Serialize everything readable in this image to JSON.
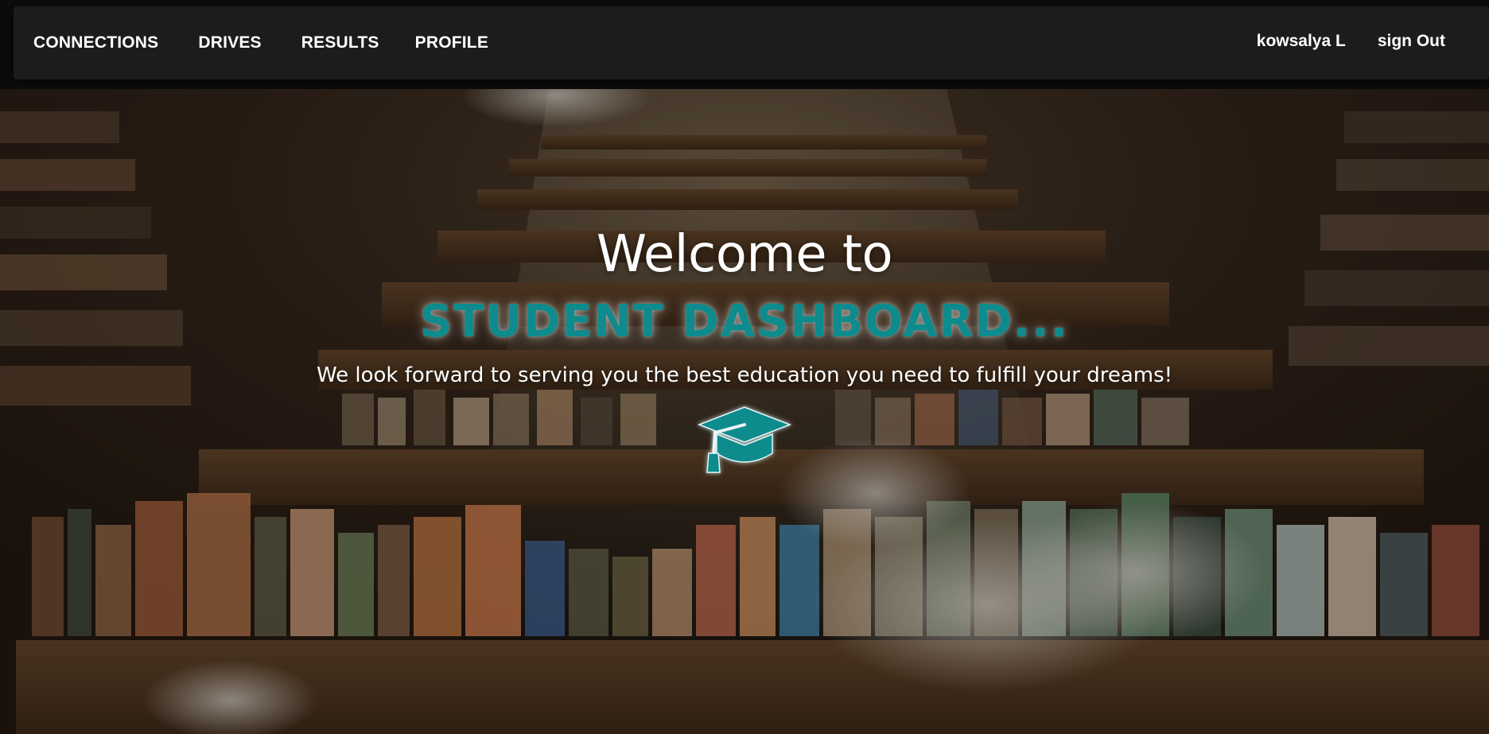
{
  "navbar": {
    "links": [
      {
        "label": "CONNECTIONS"
      },
      {
        "label": "DRIVES"
      },
      {
        "label": "RESULTS"
      },
      {
        "label": "PROFILE"
      }
    ],
    "user_name": "kowsalya L",
    "signout_label": "sign Out"
  },
  "hero": {
    "welcome": "Welcome to",
    "title": "STUDENT DASHBOARD...",
    "tagline": "We look forward to serving you the best education you need to fulfill your dreams!",
    "icon": "graduation-cap-icon"
  },
  "colors": {
    "accent": "#0e8b8d",
    "navbar_bg": "#1e1b1c",
    "text": "#ffffff"
  }
}
